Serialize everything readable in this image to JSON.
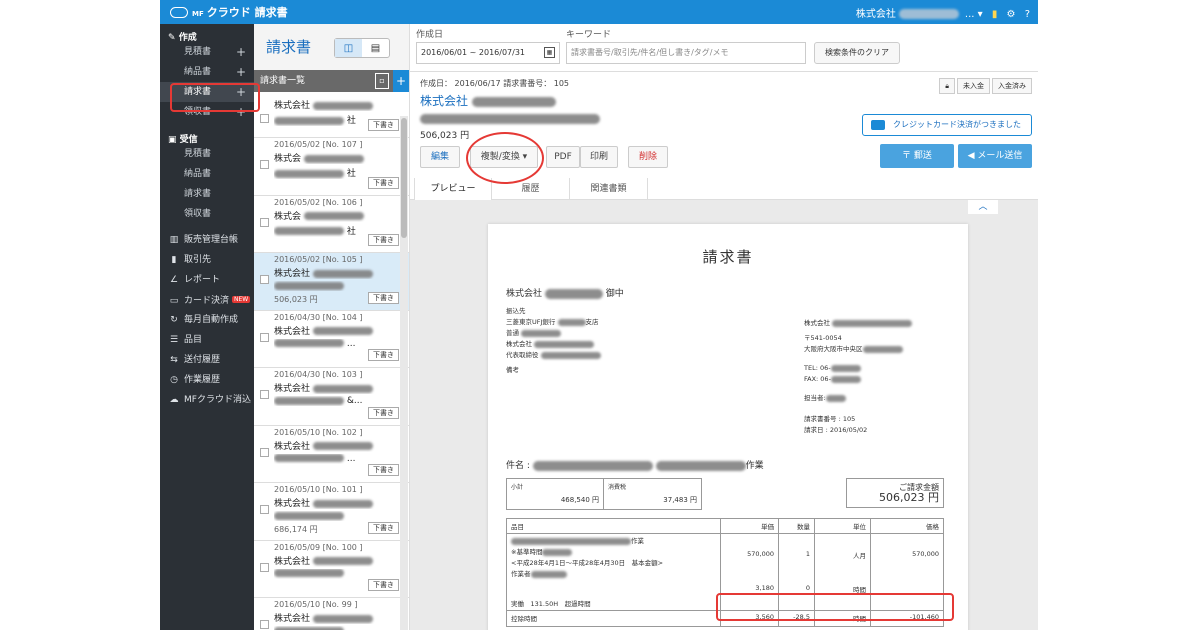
{
  "app": {
    "title": "クラウド 請求書",
    "logo_mark": "MF",
    "company": "株式会社",
    "menu_suffix": "... ▾"
  },
  "icons": {
    "top": [
      "shortcut-icon",
      "gear-icon",
      "help-icon"
    ]
  },
  "sidebar": {
    "create_section": "作成",
    "create_items": [
      "見積書",
      "納品書",
      "請求書",
      "領収書"
    ],
    "receive_section": "受信",
    "receive_items": [
      "見積書",
      "納品書",
      "請求書",
      "領収書"
    ],
    "items": [
      {
        "label": "販売管理台帳",
        "icon": "ledger-icon"
      },
      {
        "label": "取引先",
        "icon": "clients-icon"
      },
      {
        "label": "レポート",
        "icon": "report-icon"
      },
      {
        "label": "カード決済",
        "icon": "card-icon",
        "badge": "NEW"
      },
      {
        "label": "毎月自動作成",
        "icon": "auto-icon"
      },
      {
        "label": "品目",
        "icon": "items-icon"
      },
      {
        "label": "送付履歴",
        "icon": "send-history-icon"
      },
      {
        "label": "作業履歴",
        "icon": "work-history-icon"
      },
      {
        "label": "MFクラウド消込",
        "icon": "cloud-icon"
      }
    ]
  },
  "list": {
    "page_title": "請求書",
    "header": "請求書一覧",
    "rows": [
      {
        "date": "",
        "no": "",
        "name": "株式会社",
        "suffix": "社",
        "amount": "",
        "status": "下書き"
      },
      {
        "date": "2016/05/02",
        "no": "[No. 107 ]",
        "name": "株式会",
        "suffix": "社",
        "amount": "",
        "status": "下書き"
      },
      {
        "date": "2016/05/02",
        "no": "[No. 106 ]",
        "name": "株式会",
        "suffix": "社",
        "amount": "",
        "status": "下書き"
      },
      {
        "date": "2016/05/02",
        "no": "[No. 105 ]",
        "name": "株式会社",
        "suffix": "",
        "amount": "506,023 円",
        "status": "下書き"
      },
      {
        "date": "2016/04/30",
        "no": "[No. 104 ]",
        "name": "株式会社",
        "suffix": "...",
        "amount": "",
        "status": "下書き"
      },
      {
        "date": "2016/04/30",
        "no": "[No. 103 ]",
        "name": "株式会社",
        "suffix": "&...",
        "amount": "",
        "status": "下書き"
      },
      {
        "date": "2016/05/10",
        "no": "[No. 102 ]",
        "name": "株式会社",
        "suffix": "...",
        "amount": "",
        "status": "下書き"
      },
      {
        "date": "2016/05/10",
        "no": "[No. 101 ]",
        "name": "株式会社",
        "suffix": "",
        "amount": "686,174 円",
        "status": "下書き"
      },
      {
        "date": "2016/05/09",
        "no": "[No. 100 ]",
        "name": "株式会社",
        "suffix": "",
        "amount": "",
        "status": "下書き"
      },
      {
        "date": "2016/05/10",
        "no": "[No. 99 ]",
        "name": "株式会社",
        "suffix": "",
        "amount": "",
        "status": ""
      }
    ]
  },
  "filters": {
    "date_label": "作成日",
    "date_value": "2016/06/01 ~ 2016/07/31",
    "keyword_label": "キーワード",
    "keyword_placeholder": "請求書番号/取引先/件名/但し書き/タグ/メモ",
    "clear_button": "検索条件のクリア"
  },
  "detail": {
    "meta": "作成日： 2016/06/17 請求書番号： 105",
    "company": "株式会社",
    "amount": "506,023 円",
    "buttons": {
      "edit": "編集",
      "copy_convert": "複製/変換 ▾",
      "pdf": "PDF",
      "print": "印刷",
      "delete": "削除"
    },
    "status_buttons": [
      "未入金",
      "入金済み"
    ],
    "notice": "クレジットカード決済がつきました",
    "send_postal": "郵送",
    "send_mail": "メール送信",
    "tabs": [
      "プレビュー",
      "履歴",
      "関連書類"
    ]
  },
  "doc": {
    "title": "請求書",
    "to_name": "株式会社",
    "to_suffix": "御中",
    "bank_lines": [
      "振込先",
      "三菱東京UFJ銀行",
      "普通",
      "株式会社",
      "代表取締役"
    ],
    "bank_suffix": "支店",
    "remarks_label": "備考",
    "issuer_name": "株式会社",
    "postal": "〒541-0054",
    "address": "大阪府大阪市中央区",
    "tel": "TEL: 06-",
    "fax": "FAX: 06-",
    "person": "担当者:",
    "invoice_no": "請求書番号 : 105",
    "invoice_date_label": "請求日 :",
    "invoice_date": "2016/05/02",
    "subject_label": "件名 :",
    "subject_suffix": "作業",
    "subtotal_label": "小計",
    "subtotal": "468,540 円",
    "tax_label": "消費税",
    "tax": "37,483 円",
    "total_label": "ご請求金額",
    "total": "506,023 円",
    "table_headers": [
      "品目",
      "単価",
      "数量",
      "単位",
      "価格"
    ],
    "rows": [
      {
        "item": "作業",
        "note1": "※基準時間",
        "note2": "<平成28年4月1日～平成28年4月30日　基本金額>",
        "note3": "作業者",
        "unit_price": "570,000",
        "qty": "1",
        "unit": "人月",
        "price": "570,000"
      },
      {
        "item": "",
        "unit_price": "3,180",
        "qty": "0",
        "unit": "時間",
        "price": ""
      },
      {
        "item": "実働　131.50H　超過時間",
        "unit_price": "",
        "qty": "",
        "unit": "",
        "price": ""
      },
      {
        "item": "控除時間",
        "unit_price": "3,560",
        "qty": "-28.5",
        "unit": "時間",
        "price": "-101,460"
      }
    ]
  },
  "colors": {
    "brand": "#1b8ad6",
    "sidebar_bg": "#2b3036",
    "highlight": "#e53935",
    "selected_row": "#d9ebf8"
  }
}
